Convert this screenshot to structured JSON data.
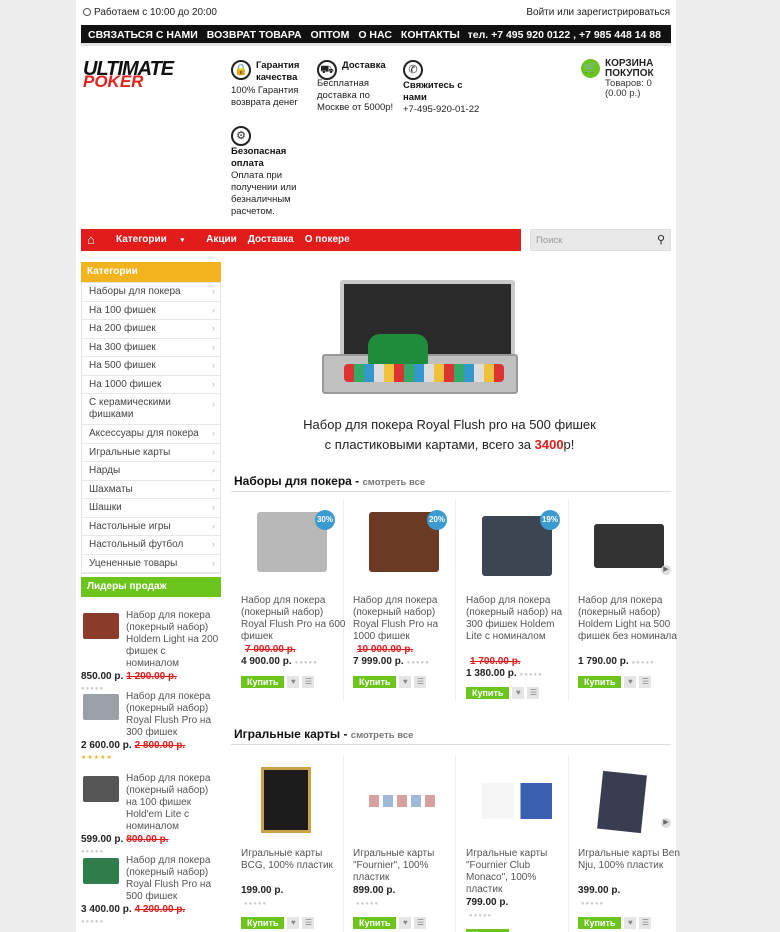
{
  "top": {
    "hours": "Работаем с 10:00 до 20:00",
    "login": "Войти или зарегистрироваться"
  },
  "nav": {
    "items": [
      "СВЯЗАТЬСЯ С НАМИ",
      "ВОЗВРАТ ТОВАРА",
      "ОПТОМ",
      "О НАС",
      "КОНТАКТЫ"
    ],
    "phones": "тел. +7 495 920 0122 , +7 985 448 14 88"
  },
  "logo": {
    "line1": "ULTIMATE",
    "line2": "POKER"
  },
  "features": [
    {
      "icon": "lock-icon",
      "title": "Гарантия качества",
      "text": "100% Гарантия возврата денег"
    },
    {
      "icon": "truck-icon",
      "title": "Доставка",
      "text": "Бесплатная доставка по Москве от 5000р!"
    },
    {
      "icon": "phone-icon",
      "title": "Свяжитесь с нами",
      "text": "+7-495-920-01-22"
    },
    {
      "icon": "secure-payment-icon",
      "title": "Безопасная оплата",
      "text": "Оплата при получении или безналичным расчетом."
    }
  ],
  "cart": {
    "title": "КОРЗИНА ПОКУПОК",
    "line1": "Товаров: 0",
    "line2": "(0.00 р.)"
  },
  "redmenu": {
    "items": [
      "Категории",
      "Акции",
      "Доставка",
      "О покере"
    ]
  },
  "search": {
    "placeholder": "Поиск"
  },
  "sidebar": {
    "categories_title": "Категории",
    "categories": [
      "Наборы для покера",
      "На 100 фишек",
      "На 200 фишек",
      "На 300 фишек",
      "На 500 фишек",
      "На 1000 фишек",
      "С керамическими фишками",
      "Аксессуары для покера",
      "Игральные карты",
      "Нарды",
      "Шахматы",
      "Шашки",
      "Настольные игры",
      "Настольный футбол",
      "Уцененные товары"
    ],
    "leaders_title": "Лидеры продаж",
    "leaders": [
      {
        "name": "Набор для покера (покерный набор) Holdem Light на 200 фишек с номиналом",
        "price": "850.00 р.",
        "old": "1 200.00 р.",
        "rating": "gray"
      },
      {
        "name": "Набор для покера (покерный набор) Royal Flush Pro на 300 фишек",
        "price": "2 600.00 р.",
        "old": "2 800.00 р.",
        "rating": "gold"
      },
      {
        "name": "Набор для покера (покерный набор) на 100 фишек Hold'em Lite с номиналом",
        "price": "599.00 р.",
        "old": "800.00 р.",
        "rating": "gray"
      },
      {
        "name": "Набор для покера (покерный набор) Royal Flush Pro на 500 фишек",
        "price": "3 400.00 р.",
        "old": "4 200.00 р.",
        "rating": "gray"
      }
    ]
  },
  "banner": {
    "line1": "Набор для покера Royal Flush pro на 500 фишек",
    "line2": "с пластиковыми картами, всего за ",
    "price": "3400",
    "suffix": "р!"
  },
  "sections": [
    {
      "title": "Наборы для покера",
      "view_all": "смотреть все",
      "products": [
        {
          "name": "Набор для покера (покерный набор) Royal Flush Pro на 600 фишек",
          "old": "7 000.00 р.",
          "price": "4 900.00 р.",
          "badge": "30%"
        },
        {
          "name": "Набор для покера (покерный набор) Royal Flush Pro на 1000 фишек",
          "old": "10 000.00 р.",
          "price": "7 999.00 р.",
          "badge": "20%"
        },
        {
          "name": "Набор для покера (покерный набор) на 300 фишек Holdem Lite с номиналом",
          "old": "1 700.00 р.",
          "price": "1 380.00 р.",
          "badge": "19%"
        },
        {
          "name": "Набор для покера (покерный набор) Holdem Light на 500 фишек без номинала",
          "old": "",
          "price": "1 790.00 р.",
          "badge": ""
        }
      ]
    },
    {
      "title": "Игральные карты",
      "view_all": "смотреть все",
      "products": [
        {
          "name": "Игральные карты BCG, 100% пластик",
          "old": "",
          "price": "199.00 р.",
          "badge": ""
        },
        {
          "name": "Игральные карты \"Fournier\", 100% пластик",
          "old": "",
          "price": "899.00 р.",
          "badge": ""
        },
        {
          "name": "Игральные карты \"Fournier Club Monaco\", 100% пластик",
          "old": "",
          "price": "799.00 р.",
          "badge": ""
        },
        {
          "name": "Игральные карты Ben Nju, 100% пластик",
          "old": "",
          "price": "399.00 р.",
          "badge": ""
        }
      ]
    }
  ],
  "buy_label": "Купить",
  "colors": {
    "red": "#e21b1b",
    "green": "#6cc51c",
    "orange": "#f2b31e",
    "blue_badge": "#3b9bd1"
  }
}
